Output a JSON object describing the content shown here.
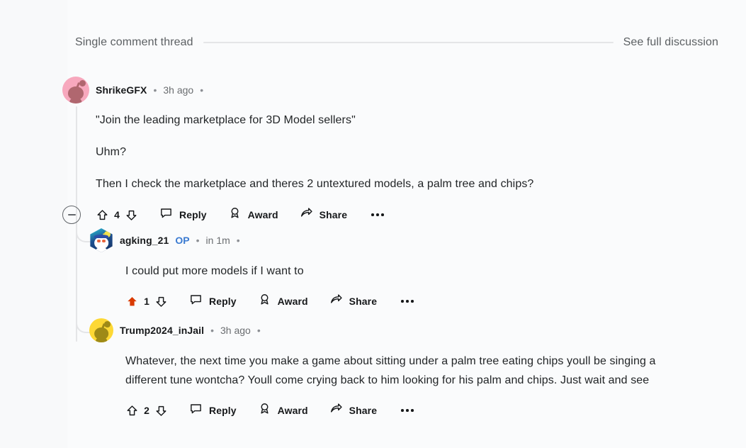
{
  "header": {
    "title": "Single comment thread",
    "full_discussion_link": "See full discussion"
  },
  "labels": {
    "reply": "Reply",
    "award": "Award",
    "share": "Share",
    "dot": "•",
    "op": "OP"
  },
  "colors": {
    "page_background": "#f7f8f9",
    "text_primary": "#16181a",
    "text_secondary": "#6a6d70",
    "thread_line": "#e4e5e7",
    "op_badge": "#3a7ad1",
    "upvote_active": "#d93a00"
  },
  "comments": [
    {
      "author": "ShrikeGFX",
      "timestamp": "3h ago",
      "avatar": "pink-snoo-avatar",
      "is_op": false,
      "score": "4",
      "upvoted": false,
      "collapsible": true,
      "paragraphs": [
        "\"Join the leading marketplace for 3D Model sellers\"",
        "Uhm?",
        "Then I check the marketplace and theres 2 untextured models, a palm tree and chips?"
      ]
    },
    {
      "author": "agking_21",
      "timestamp": "in 1m",
      "avatar": "hexagonal-nft-snoo-avatar",
      "is_op": true,
      "score": "1",
      "upvoted": true,
      "collapsible": false,
      "paragraphs": [
        "I could put more models if I want to"
      ]
    },
    {
      "author": "Trump2024_inJail",
      "timestamp": "3h ago",
      "avatar": "yellow-snoo-avatar",
      "is_op": false,
      "score": "2",
      "upvoted": false,
      "collapsible": false,
      "paragraphs": [
        "Whatever, the next time you make a game about sitting under a palm tree eating chips youll be singing a different tune wontcha? Youll come crying back to him looking for his palm and chips. Just wait and see"
      ]
    }
  ]
}
